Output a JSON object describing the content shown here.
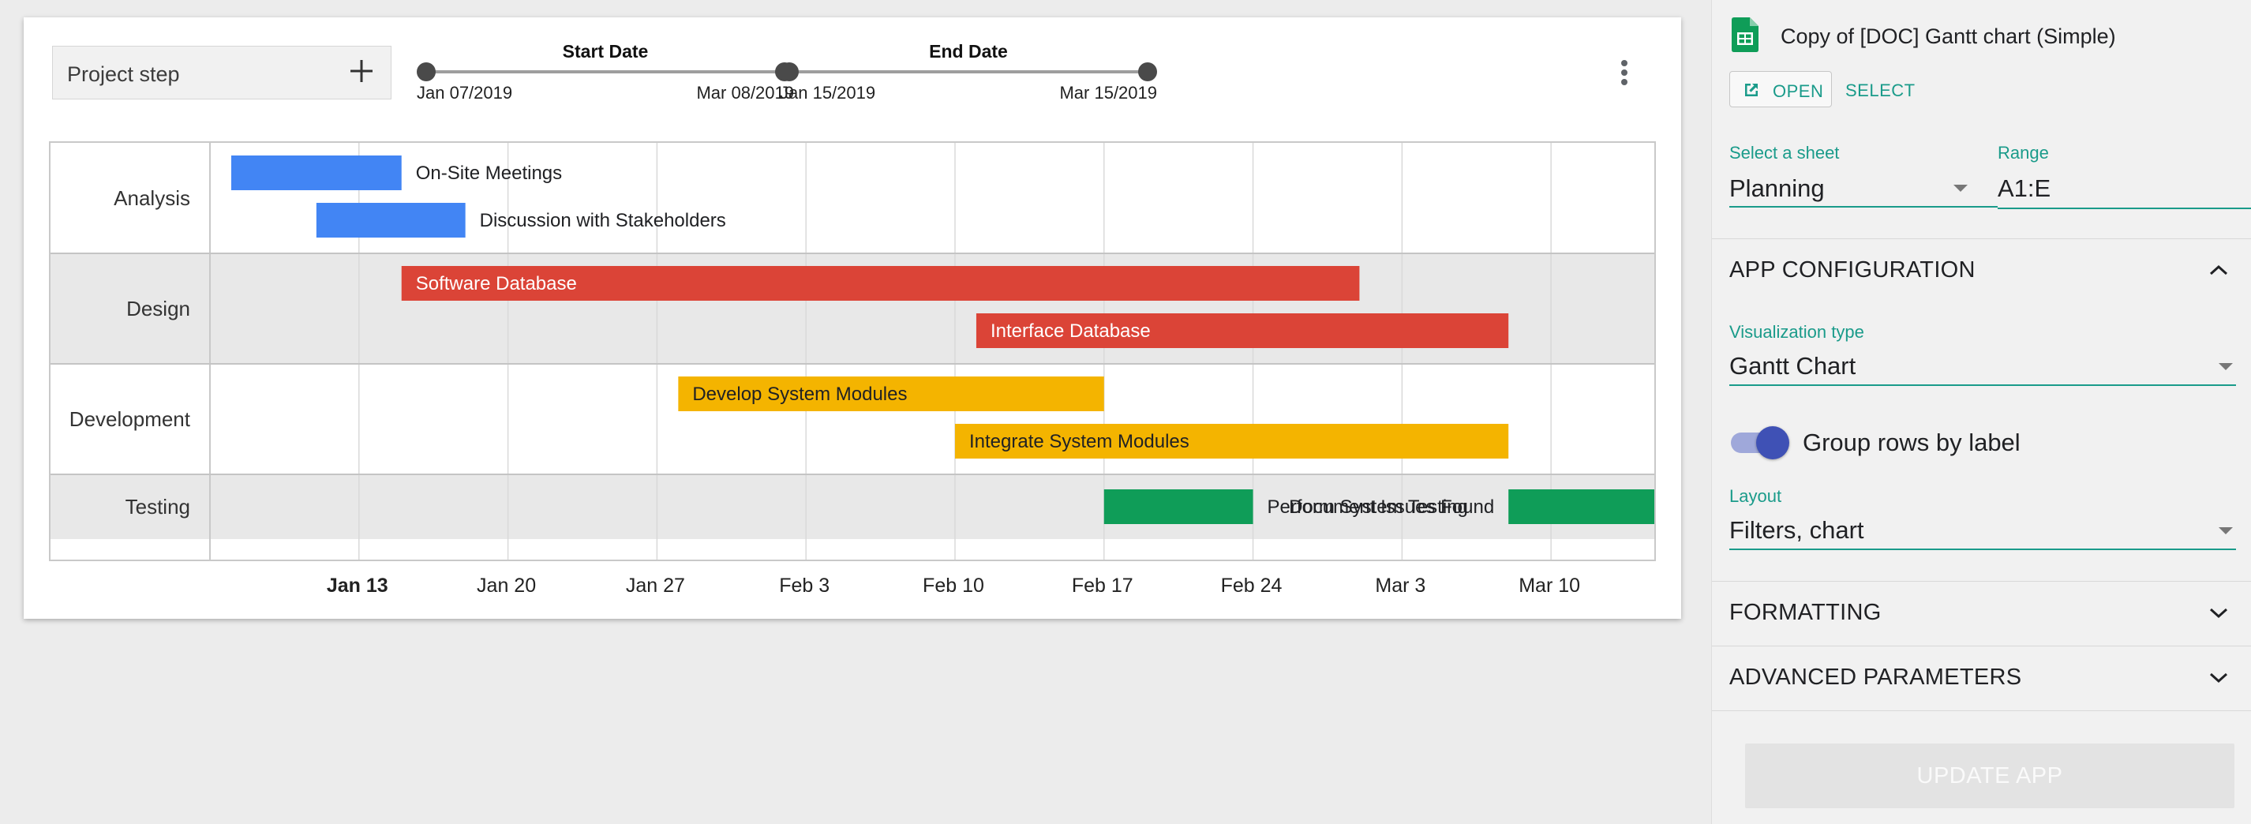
{
  "filters": {
    "category_label": "Project step",
    "start_date": {
      "title": "Start Date",
      "min_label": "Jan 07/2019",
      "max_label": "Mar 08/2019"
    },
    "end_date": {
      "title": "End Date",
      "min_label": "Jan 15/2019",
      "max_label": "Mar 15/2019"
    }
  },
  "chart_data": {
    "type": "gantt",
    "x_axis": {
      "start": "2019-01-06",
      "end": "2019-03-15",
      "ticks": [
        {
          "date": "2019-01-13",
          "label": "Jan 13",
          "bold": true
        },
        {
          "date": "2019-01-20",
          "label": "Jan 20"
        },
        {
          "date": "2019-01-27",
          "label": "Jan 27"
        },
        {
          "date": "2019-02-03",
          "label": "Feb 3"
        },
        {
          "date": "2019-02-10",
          "label": "Feb 10"
        },
        {
          "date": "2019-02-17",
          "label": "Feb 17"
        },
        {
          "date": "2019-02-24",
          "label": "Feb 24"
        },
        {
          "date": "2019-03-03",
          "label": "Mar 3"
        },
        {
          "date": "2019-03-10",
          "label": "Mar 10"
        }
      ]
    },
    "groups": [
      {
        "label": "Analysis",
        "color": "#4285f4",
        "tasks": [
          {
            "name": "On-Site Meetings",
            "start": "2019-01-07",
            "end": "2019-01-15"
          },
          {
            "name": "Discussion with Stakeholders",
            "start": "2019-01-11",
            "end": "2019-01-18"
          }
        ]
      },
      {
        "label": "Design",
        "color": "#db4437",
        "tasks": [
          {
            "name": "Software Database",
            "start": "2019-01-15",
            "end": "2019-03-01"
          },
          {
            "name": "Interface Database",
            "start": "2019-02-11",
            "end": "2019-03-08"
          }
        ]
      },
      {
        "label": "Development",
        "color": "#f4b400",
        "tasks": [
          {
            "name": "Develop System Modules",
            "start": "2019-01-28",
            "end": "2019-02-17"
          },
          {
            "name": "Integrate System Modules",
            "start": "2019-02-10",
            "end": "2019-03-08"
          }
        ]
      },
      {
        "label": "Testing",
        "color": "#0f9d58",
        "tasks": [
          {
            "name": "Perform System Testing",
            "start": "2019-02-17",
            "end": "2019-02-24"
          },
          {
            "name": "Document Issues Found",
            "start": "2019-03-08",
            "end": "2019-03-15"
          }
        ]
      }
    ]
  },
  "panel": {
    "doc_title": "Copy of [DOC] Gantt chart (Simple)",
    "open_label": "OPEN",
    "select_label": "SELECT",
    "sheet_label": "Select a sheet",
    "sheet_value": "Planning",
    "range_label": "Range",
    "range_value": "A1:E",
    "app_config_title": "APP CONFIGURATION",
    "viz_label": "Visualization type",
    "viz_value": "Gantt Chart",
    "group_rows_label": "Group rows by label",
    "group_rows_on": true,
    "layout_label": "Layout",
    "layout_value": "Filters, chart",
    "formatting_title": "FORMATTING",
    "advanced_title": "ADVANCED PARAMETERS",
    "update_label": "UPDATE APP",
    "accent_color": "#1a9b8a"
  }
}
